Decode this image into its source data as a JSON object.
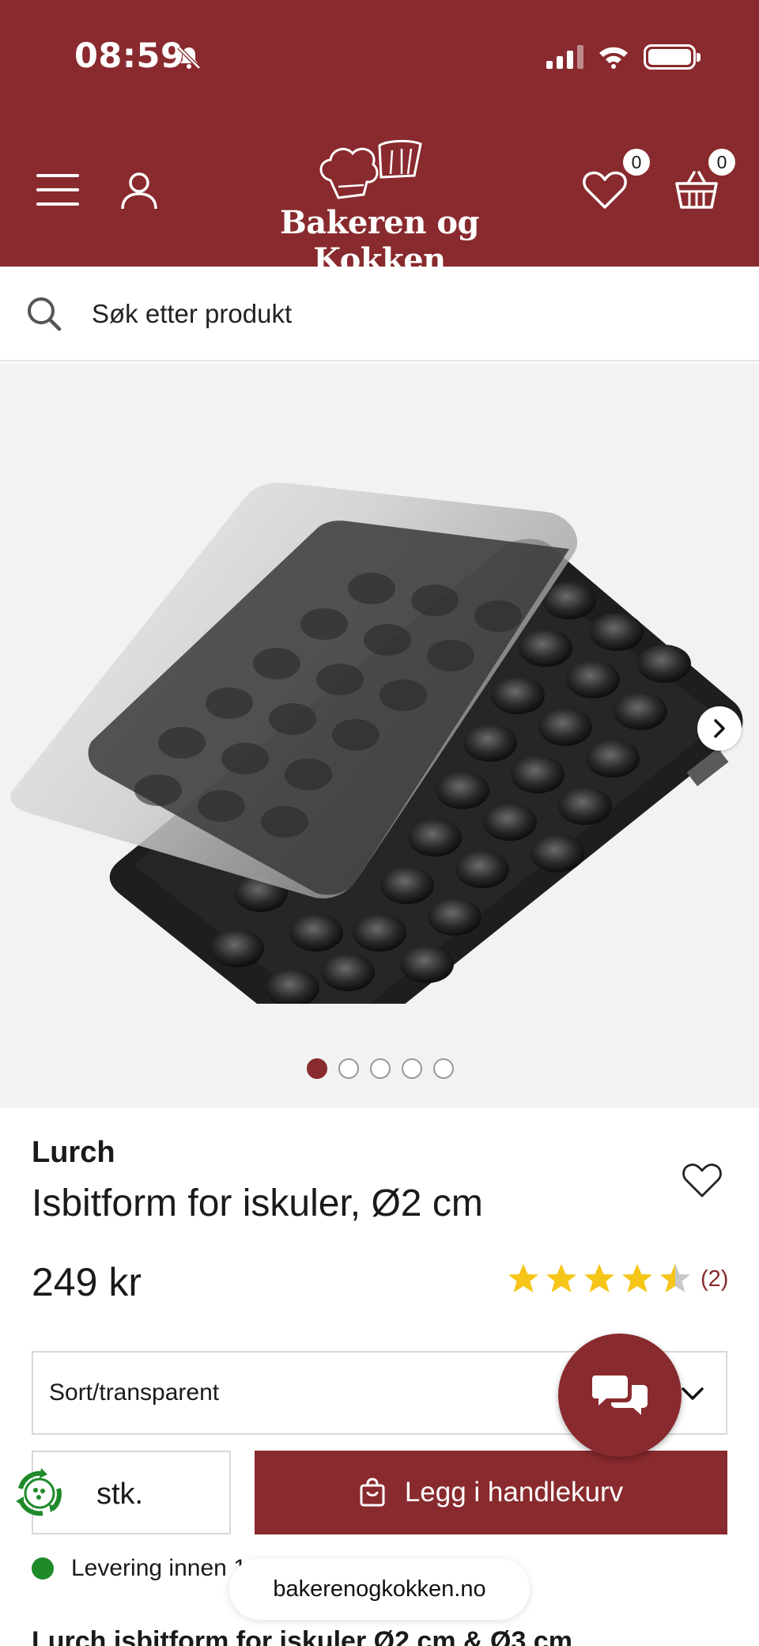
{
  "status_bar": {
    "time": "08:59",
    "icons": [
      "bell-off-icon",
      "signal-icon",
      "wifi-icon",
      "battery-icon"
    ]
  },
  "header": {
    "logo_text": "Bakeren og Kokken",
    "wishlist_count": "0",
    "cart_count": "0",
    "icons": [
      "menu-icon",
      "user-icon",
      "heart-icon",
      "basket-icon"
    ],
    "bg_color": "#892a2e"
  },
  "search": {
    "placeholder": "Søk etter produkt"
  },
  "gallery": {
    "slide_count": 5,
    "active_slide": 1
  },
  "product": {
    "brand": "Lurch",
    "title": "Isbitform for iskuler, Ø2 cm",
    "price": "249 kr",
    "rating_value": 4.5,
    "rating_count": "(2)",
    "variant": "Sort/transparent",
    "quantity_label": "stk.",
    "add_to_cart_label": "Legg i handlekurv",
    "delivery_text": "Levering innen 1",
    "description_heading": "Lurch isbitform for iskuler Ø2 cm & Ø3 cm"
  },
  "browser": {
    "url": "bakerenogkokken.no"
  }
}
